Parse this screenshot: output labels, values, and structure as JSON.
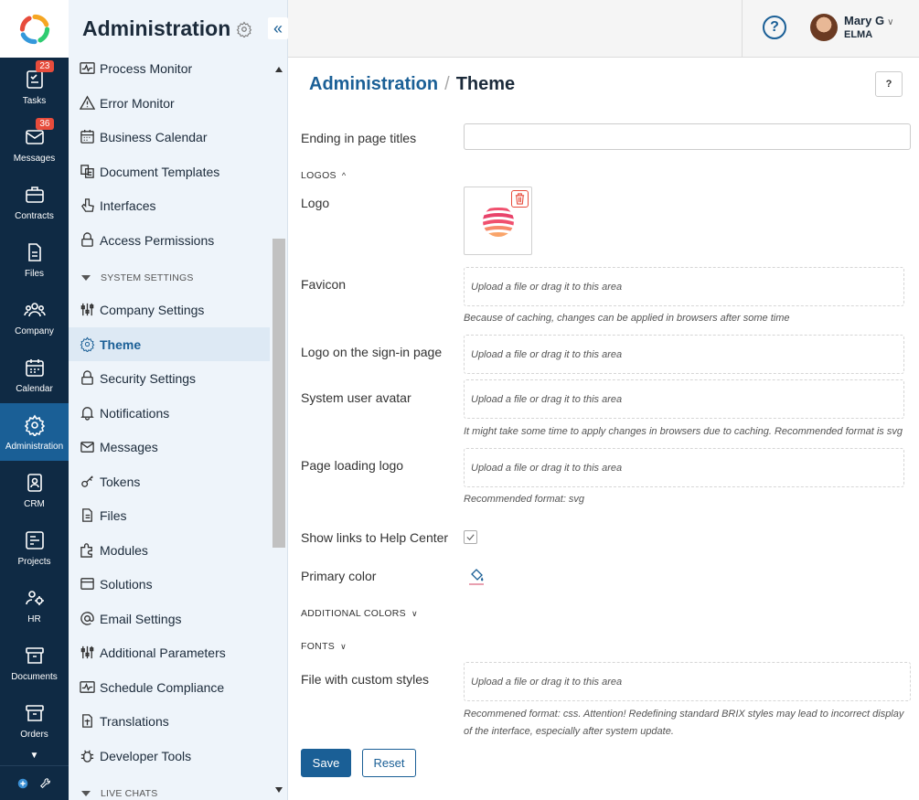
{
  "colors": {
    "rail_bg": "#0f2a44",
    "rail_active": "#1a5f96",
    "accent": "#1a5f96",
    "badge": "#e74c3c",
    "sidebar_bg": "#eef4fa"
  },
  "rail": {
    "items": [
      {
        "label": "Tasks",
        "icon": "tasks-icon",
        "badge": "23"
      },
      {
        "label": "Messages",
        "icon": "messages-icon",
        "badge": "36"
      },
      {
        "label": "Contracts",
        "icon": "briefcase-icon"
      },
      {
        "label": "Files",
        "icon": "file-icon"
      },
      {
        "label": "Company",
        "icon": "people-icon"
      },
      {
        "label": "Calendar",
        "icon": "calendar-icon"
      },
      {
        "label": "Administration",
        "icon": "gear-icon",
        "active": true
      },
      {
        "label": "CRM",
        "icon": "contact-card-icon"
      },
      {
        "label": "Projects",
        "icon": "projects-icon"
      },
      {
        "label": "HR",
        "icon": "hr-icon"
      },
      {
        "label": "Documents",
        "icon": "archive-icon"
      },
      {
        "label": "Orders",
        "icon": "archive-icon"
      }
    ]
  },
  "sidebar": {
    "title": "Administration",
    "items": [
      {
        "label": "Process Monitor",
        "icon": "pulse-icon"
      },
      {
        "label": "Error Monitor",
        "icon": "warning-icon"
      },
      {
        "label": "Business Calendar",
        "icon": "calendar-icon"
      },
      {
        "label": "Document Templates",
        "icon": "templates-icon"
      },
      {
        "label": "Interfaces",
        "icon": "pointer-icon"
      },
      {
        "label": "Access Permissions",
        "icon": "lock-icon"
      }
    ],
    "section_system": "SYSTEM SETTINGS",
    "system_items": [
      {
        "label": "Company Settings",
        "icon": "sliders-icon"
      },
      {
        "label": "Theme",
        "icon": "gear-icon",
        "active": true
      },
      {
        "label": "Security Settings",
        "icon": "lock-icon"
      },
      {
        "label": "Notifications",
        "icon": "bell-icon"
      },
      {
        "label": "Messages",
        "icon": "envelope-icon"
      },
      {
        "label": "Tokens",
        "icon": "key-icon"
      },
      {
        "label": "Files",
        "icon": "file-icon"
      },
      {
        "label": "Modules",
        "icon": "puzzle-icon"
      },
      {
        "label": "Solutions",
        "icon": "window-icon"
      },
      {
        "label": "Email Settings",
        "icon": "at-icon"
      },
      {
        "label": "Additional Parameters",
        "icon": "sliders-icon"
      },
      {
        "label": "Schedule Compliance",
        "icon": "pulse-icon"
      },
      {
        "label": "Translations",
        "icon": "translate-icon"
      },
      {
        "label": "Developer Tools",
        "icon": "bug-icon"
      }
    ],
    "section_live": "LIVE CHATS"
  },
  "topbar": {
    "user_name": "Mary G",
    "company": "ELMA"
  },
  "page": {
    "breadcrumb_root": "Administration",
    "breadcrumb_sep": "/",
    "breadcrumb_current": "Theme",
    "help_label": "?"
  },
  "form": {
    "ending_label": "Ending in page titles",
    "ending_value": "",
    "logos_section": "LOGOS",
    "logo_label": "Logo",
    "favicon_label": "Favicon",
    "upload_placeholder": "Upload a file or drag it to this area",
    "favicon_hint": "Because of caching, changes can be applied in browsers after some time",
    "signin_logo_label": "Logo on the sign-in page",
    "system_avatar_label": "System user avatar",
    "avatar_hint": "It might take some time to apply changes in browsers due to caching. Recommended format is svg",
    "loading_logo_label": "Page loading logo",
    "loading_hint": "Recommended format: svg",
    "help_links_label": "Show links to Help Center",
    "help_links_checked": true,
    "primary_color_label": "Primary color",
    "additional_colors_section": "ADDITIONAL COLORS",
    "fonts_section": "FONTS",
    "custom_styles_label": "File with custom styles",
    "custom_styles_hint": "Recommened format: css. Attention! Redefining standard BRIX styles may lead to incorrect display of the interface, especially after system update.",
    "save_label": "Save",
    "reset_label": "Reset"
  }
}
